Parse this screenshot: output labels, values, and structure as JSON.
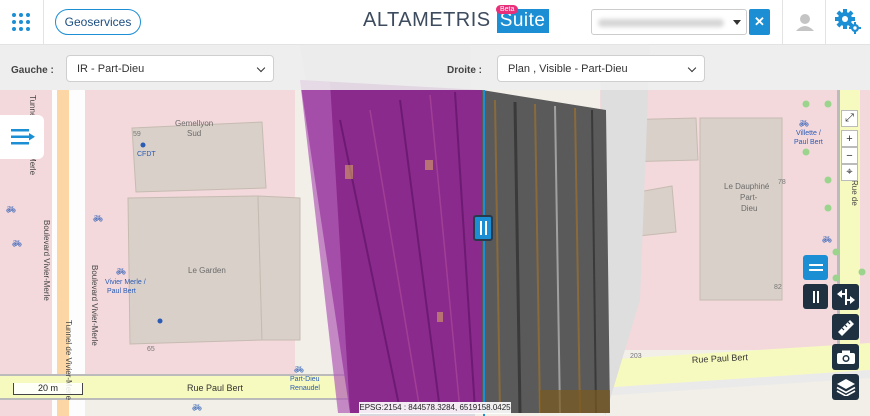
{
  "header": {
    "geoservices_label": "Geoservices",
    "logo_alta": "ALTA",
    "logo_metris": "METRIS ",
    "logo_suite": "Suite",
    "beta_badge": "Beta"
  },
  "toolbar": {
    "left_label": "Gauche :",
    "left_value": "IR - Part-Dieu",
    "right_label": "Droite :",
    "right_value": "Plan , Visible - Part-Dieu"
  },
  "map": {
    "labels": {
      "gemellyon": "Gemellyon",
      "gemellyon_sud": "Sud",
      "num_59": "59",
      "cfdt": "CFDT",
      "le_garden": "Le Garden",
      "vivier_merle_bus": "Vivier Merle /",
      "paul_bert_bus": "Paul Bert",
      "num_65": "65",
      "tunnel_vivier_merle": "Tunnel de Vivier-Merle",
      "boulevard_vivier_merle": "Boulevard Vivier-Merle",
      "boulevard_vivier_merle_2": "Boulevard Vivier-Merle",
      "rue_paul_bert_left": "Rue Paul Bert",
      "part_dieu_renaudel_1": "Part-Dieu",
      "part_dieu_renaudel_2": "Renaudel",
      "le_dauphine_1": "Le Dauphiné",
      "le_dauphine_2": "Part-",
      "le_dauphine_3": "Dieu",
      "num_78": "78",
      "num_82": "82",
      "num_203": "203",
      "rue_paul_bert_right": "Rue Paul Bert",
      "villette_1": "Villette /",
      "villette_2": "Paul Bert",
      "rue_de": "Rue de"
    },
    "scale_label": "20 m",
    "epsg": "EPSG:2154 : 844578.3284, 6519158.0425"
  },
  "colors": {
    "accent": "#1c8fd4",
    "dark_button": "#1f3140",
    "beta": "#e8307a",
    "ir_magenta": "#8a2a8c"
  }
}
